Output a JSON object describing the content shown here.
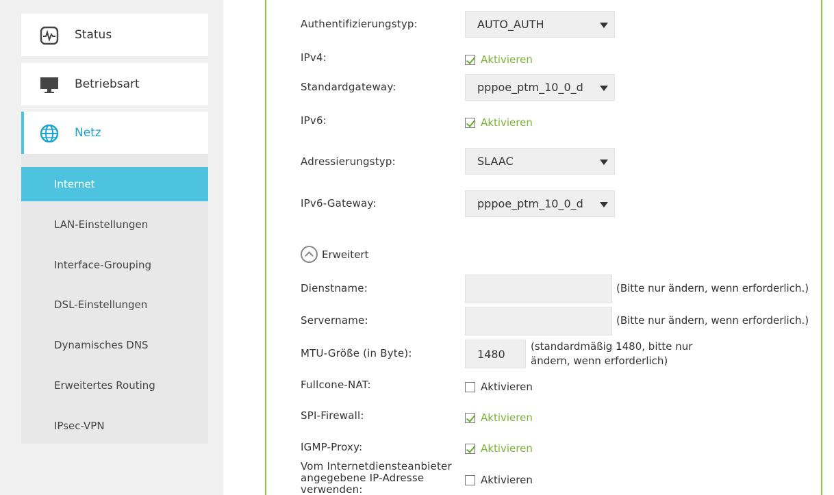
{
  "sidebar": {
    "main": [
      {
        "label": "Status",
        "icon": "status-pulse-icon"
      },
      {
        "label": "Betriebsart",
        "icon": "monitor-icon"
      },
      {
        "label": "Netz",
        "icon": "globe-icon",
        "active": true
      }
    ],
    "sub": [
      {
        "label": "Internet",
        "active": true
      },
      {
        "label": "LAN-Einstellungen"
      },
      {
        "label": "Interface-Grouping"
      },
      {
        "label": "DSL-Einstellungen"
      },
      {
        "label": "Dynamisches DNS"
      },
      {
        "label": "Erweitertes Routing"
      },
      {
        "label": "IPsec-VPN"
      }
    ]
  },
  "form": {
    "auth_label": "Authentifizierungstyp:",
    "auth_value": "AUTO_AUTH",
    "ipv4_label": "IPv4:",
    "ipv4_check": "Aktivieren",
    "gw_label": "Standardgateway:",
    "gw_value": "pppoe_ptm_10_0_d",
    "ipv6_label": "IPv6:",
    "ipv6_check": "Aktivieren",
    "addr_label": "Adressierungstyp:",
    "addr_value": "SLAAC",
    "ipv6gw_label": "IPv6-Gateway:",
    "ipv6gw_value": "pppoe_ptm_10_0_d",
    "advanced_label": "Erweitert",
    "service_label": "Dienstname:",
    "service_value": "",
    "service_note": "(Bitte nur ändern, wenn erforderlich.)",
    "server_label": "Servername:",
    "server_value": "",
    "server_note": "(Bitte nur ändern, wenn erforderlich.)",
    "mtu_label": "MTU-Größe (in Byte):",
    "mtu_value": "1480",
    "mtu_note_1": "(standardmäßig 1480, bitte nur",
    "mtu_note_2": "ändern, wenn erforderlich)",
    "fullcone_label": "Fullcone-NAT:",
    "fullcone_check": "Aktivieren",
    "spi_label": "SPI-Firewall:",
    "spi_check": "Aktivieren",
    "igmp_label": "IGMP-Proxy:",
    "igmp_check": "Aktivieren",
    "isp_label_1": "Vom Internetdiensteanbieter",
    "isp_label_2": "angegebene IP-Adresse",
    "isp_label_3": "verwenden:",
    "isp_check": "Aktivieren"
  },
  "colors": {
    "accent_blue": "#4ec3e0",
    "accent_green": "#8cc63f",
    "check_green": "#7ab335"
  }
}
